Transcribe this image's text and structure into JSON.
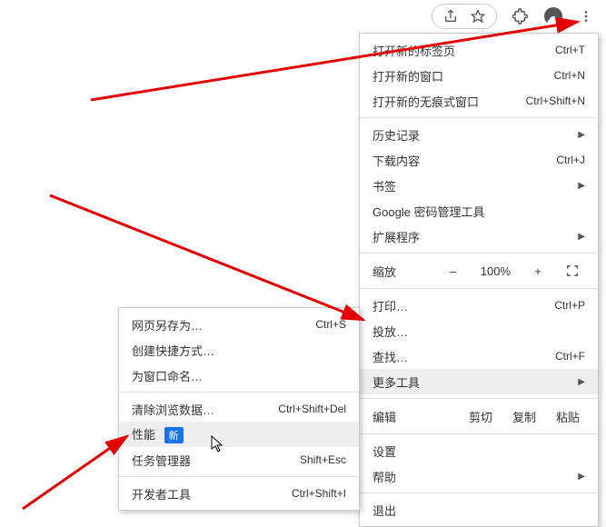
{
  "toolbar": {
    "share_icon": "share-icon",
    "star_icon": "star-icon",
    "extensions_icon": "extensions-icon",
    "profile_icon": "profile-icon",
    "menu_icon": "menu-kebab-icon"
  },
  "main_menu": {
    "new_tab": {
      "label": "打开新的标签页",
      "shortcut": "Ctrl+T"
    },
    "new_window": {
      "label": "打开新的窗口",
      "shortcut": "Ctrl+N"
    },
    "new_incognito": {
      "label": "打开新的无痕式窗口",
      "shortcut": "Ctrl+Shift+N"
    },
    "history": {
      "label": "历史记录"
    },
    "downloads": {
      "label": "下载内容",
      "shortcut": "Ctrl+J"
    },
    "bookmarks": {
      "label": "书签"
    },
    "passwords": {
      "label": "Google 密码管理工具"
    },
    "extensions": {
      "label": "扩展程序"
    },
    "zoom": {
      "label": "缩放",
      "minus": "–",
      "value": "100%",
      "plus": "+"
    },
    "print": {
      "label": "打印…",
      "shortcut": "Ctrl+P"
    },
    "cast": {
      "label": "投放…"
    },
    "find": {
      "label": "查找…",
      "shortcut": "Ctrl+F"
    },
    "more_tools": {
      "label": "更多工具"
    },
    "edit": {
      "label": "编辑",
      "cut": "剪切",
      "copy": "复制",
      "paste": "粘贴"
    },
    "settings": {
      "label": "设置"
    },
    "help": {
      "label": "帮助"
    },
    "exit": {
      "label": "退出"
    }
  },
  "sub_menu": {
    "save_as": {
      "label": "网页另存为…",
      "shortcut": "Ctrl+S"
    },
    "create_shortcut": {
      "label": "创建快捷方式…"
    },
    "name_window": {
      "label": "为窗口命名…"
    },
    "clear_data": {
      "label": "清除浏览数据…",
      "shortcut": "Ctrl+Shift+Del"
    },
    "performance": {
      "label": "性能",
      "badge": "新"
    },
    "task_manager": {
      "label": "任务管理器",
      "shortcut": "Shift+Esc"
    },
    "dev_tools": {
      "label": "开发者工具",
      "shortcut": "Ctrl+Shift+I"
    }
  }
}
